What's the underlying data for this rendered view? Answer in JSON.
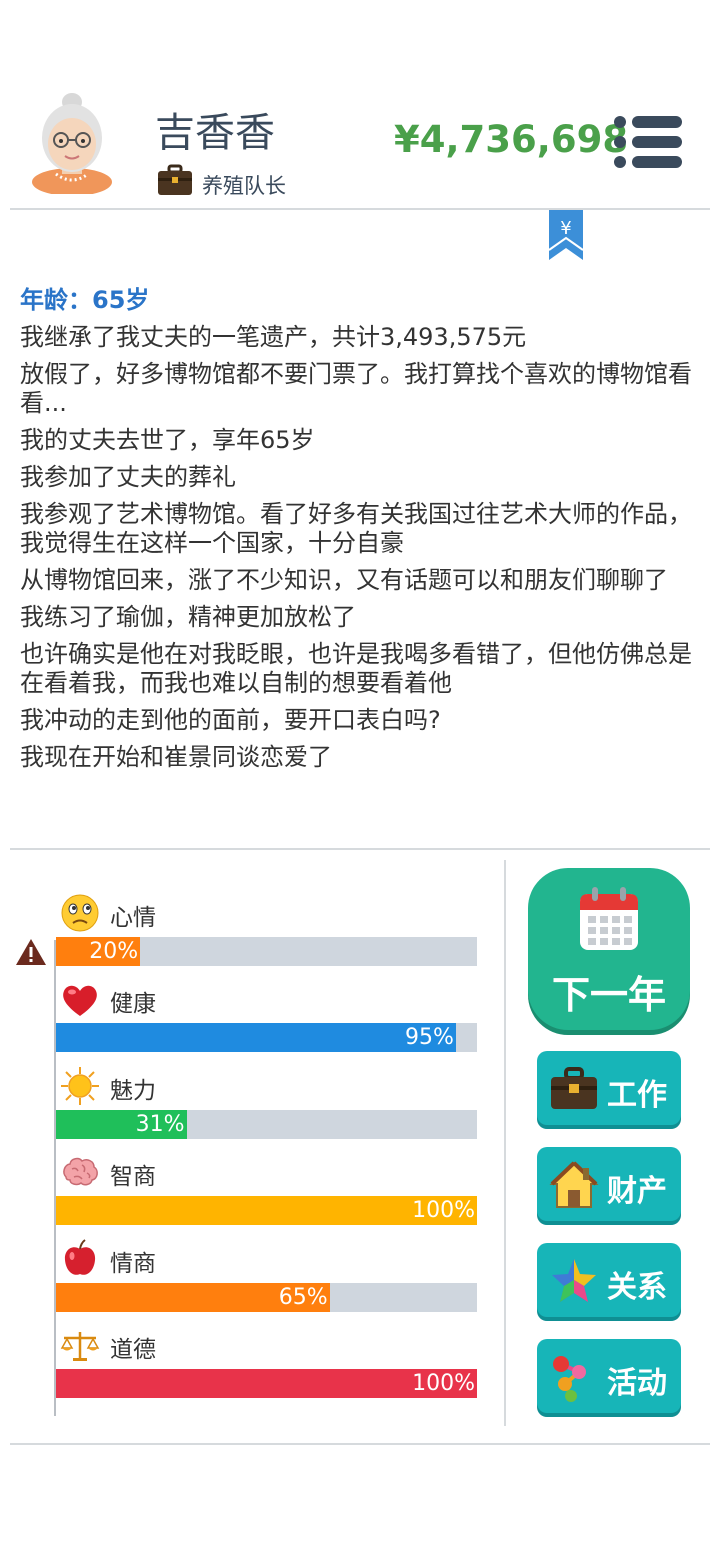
{
  "profile": {
    "name": "吉香香",
    "job": "养殖队长",
    "money": "¥4,736,698"
  },
  "log": {
    "age": "年龄：65岁",
    "lines": [
      "我继承了我丈夫的一笔遗产，共计3,493,575元",
      "放假了，好多博物馆都不要门票了。我打算找个喜欢的博物馆看看...",
      "我的丈夫去世了，享年65岁",
      "我参加了丈夫的葬礼",
      "我参观了艺术博物馆。看了好多有关我国过往艺术大师的作品，我觉得生在这样一个国家，十分自豪",
      "从博物馆回来，涨了不少知识，又有话题可以和朋友们聊聊了",
      "我练习了瑜伽，精神更加放松了",
      "也许确实是他在对我眨眼，也许是我喝多看错了，但他仿佛总是在看着我，而我也难以自制的想要看着他",
      "我冲动的走到他的面前，要开口表白吗?",
      "我现在开始和崔景同谈恋爱了"
    ]
  },
  "stats": [
    {
      "label": "心情",
      "value": 20,
      "text": "20%",
      "color": "#ff7f0e",
      "icon": "sad-face-icon",
      "warning": true
    },
    {
      "label": "健康",
      "value": 95,
      "text": "95%",
      "color": "#1f8be0",
      "icon": "heart-icon"
    },
    {
      "label": "魅力",
      "value": 31,
      "text": "31%",
      "color": "#1fbf5a",
      "icon": "sun-icon"
    },
    {
      "label": "智商",
      "value": 100,
      "text": "100%",
      "color": "#ffb400",
      "icon": "brain-icon"
    },
    {
      "label": "情商",
      "value": 65,
      "text": "65%",
      "color": "#ff7f0e",
      "icon": "apple-icon"
    },
    {
      "label": "道德",
      "value": 100,
      "text": "100%",
      "color": "#e8334a",
      "icon": "scales-icon"
    }
  ],
  "buttons": {
    "next_year": "下一年",
    "work": "工作",
    "property": "财产",
    "relations": "关系",
    "activities": "活动"
  }
}
